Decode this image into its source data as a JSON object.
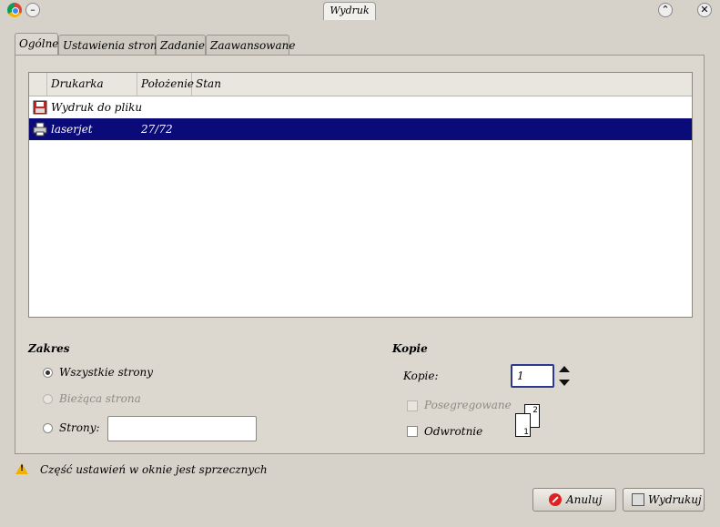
{
  "window": {
    "title": "Wydruk",
    "minimize_glyph": "–",
    "maximize_glyph": "⌃",
    "close_glyph": "✕"
  },
  "tabs": [
    {
      "label": "Ogólne",
      "active": true
    },
    {
      "label": "Ustawienia strony",
      "active": false
    },
    {
      "label": "Zadanie",
      "active": false
    },
    {
      "label": "Zaawansowane",
      "active": false
    }
  ],
  "printer_list": {
    "columns": [
      "Drukarka",
      "Położenie",
      "Stan"
    ],
    "rows": [
      {
        "icon": "save-file-icon",
        "name": "Wydruk do pliku",
        "location": "",
        "status": "",
        "selected": false
      },
      {
        "icon": "printer-icon",
        "name": "laserjet",
        "location": "27/72",
        "status": "",
        "selected": true
      }
    ]
  },
  "range": {
    "title": "Zakres",
    "all_pages": "Wszystkie strony",
    "current_page": "Bieżąca strona",
    "pages": "Strony:",
    "pages_value": "",
    "selected": "all_pages"
  },
  "copies": {
    "title": "Kopie",
    "label": "Kopie:",
    "value": "1",
    "collate": "Posegregowane",
    "collate_checked": false,
    "collate_disabled": true,
    "reverse": "Odwrotnie",
    "reverse_checked": false,
    "preview_page_1": "1",
    "preview_page_2": "2"
  },
  "warning": {
    "icon": "warning-icon",
    "text": "Część ustawień w oknie jest sprzecznych"
  },
  "buttons": {
    "cancel": {
      "label": "Anuluj",
      "icon": "cancel-icon"
    },
    "print": {
      "label": "Wydrukuj",
      "icon": "printer-icon"
    }
  },
  "colors": {
    "selection": "#0a0a78",
    "background": "#d6d2ca",
    "warning": "#f2b100"
  }
}
